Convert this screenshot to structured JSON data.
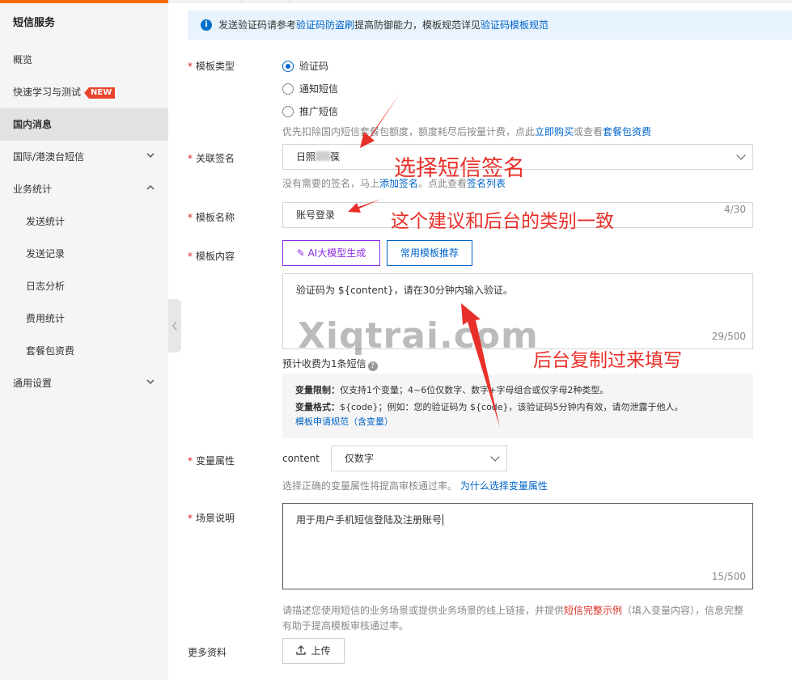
{
  "sidebar": {
    "title": "短信服务",
    "items": [
      {
        "label": "概览"
      },
      {
        "label": "快速学习与测试",
        "badge": "NEW"
      },
      {
        "label": "国内消息",
        "active": true
      },
      {
        "label": "国际/港澳台短信",
        "chevron": "chevron-down"
      },
      {
        "label": "业务统计",
        "chevron": "chevron-up"
      },
      {
        "label": "发送统计",
        "sub": true
      },
      {
        "label": "发送记录",
        "sub": true
      },
      {
        "label": "日志分析",
        "sub": true
      },
      {
        "label": "费用统计",
        "sub": true
      },
      {
        "label": "套餐包资费",
        "sub": true
      },
      {
        "label": "通用设置",
        "chevron": "chevron-down"
      }
    ]
  },
  "notice": {
    "icon": "info-icon",
    "text_1": "发送验证码请参考",
    "link_1": "验证码防盗刷",
    "text_2": "提高防御能力，模板规范详见",
    "link_2": "验证码模板规范"
  },
  "form": {
    "template_type": {
      "label": "模板类型",
      "options": [
        "验证码",
        "通知短信",
        "推广短信"
      ],
      "selected": "验证码",
      "hint_text": "优先扣除国内短信套餐包额度，额度耗尽后按量计费，点此",
      "hint_link_1": "立即购买",
      "hint_mid": "或查看",
      "hint_link_2": "套餐包资费"
    },
    "signature": {
      "label": "关联签名",
      "value": "日照",
      "value_tail": "葆",
      "hint_text": "没有需要的签名，马上",
      "hint_link_1": "添加签名",
      "hint_mid": "。点此查看",
      "hint_link_2": "签名列表"
    },
    "template_name": {
      "label": "模板名称",
      "value": "账号登录",
      "counter": "4/30"
    },
    "template_content": {
      "label": "模板内容",
      "ai_button": "AI大模型生成",
      "recommend_button": "常用模板推荐",
      "value": "验证码为 ${content}，请在30分钟内输入验证。",
      "counter": "29/500",
      "estimate": "预计收费为1条短信",
      "rules_limit_title": "变量限制：",
      "rules_limit_text": "仅支持1个变量；4~6位仅数字、数字+字母组合或仅字母2种类型。",
      "rules_format_title": "变量格式：",
      "rules_format_text": "${code}；例如：您的验证码为 ${code}，该验证码5分钟内有效，请勿泄露于他人。",
      "rules_link": "模板申请规范（含变量）"
    },
    "variable": {
      "label": "变量属性",
      "name": "content",
      "select_value": "仅数字",
      "hint_text": "选择正确的变量属性将提高审核通过率。",
      "hint_link": "为什么选择变量属性"
    },
    "scene": {
      "label": "场景说明",
      "value": "用于用户手机短信登陆及注册账号",
      "counter": "15/500",
      "hint_text_1": "请描述您使用短信的业务场景或提供业务场景的线上链接，并提供",
      "hint_link": "短信完整示例",
      "hint_text_2": "（填入变量内容），信息完整",
      "hint_text_3": "有助于提高模板审核通过率。"
    },
    "more": {
      "label": "更多资料",
      "upload_button": "上传"
    }
  },
  "annotations": {
    "choose_signature": "选择短信签名",
    "name_advice": "这个建议和后台的类别一致",
    "copy_from_backend": "后台复制过来填写",
    "watermark": "Xiqtrai.com"
  },
  "colors": {
    "accent": "#ff6a00",
    "link": "#0064c8",
    "annotation": "#e8302a",
    "ai_purple": "#8a2be2"
  }
}
